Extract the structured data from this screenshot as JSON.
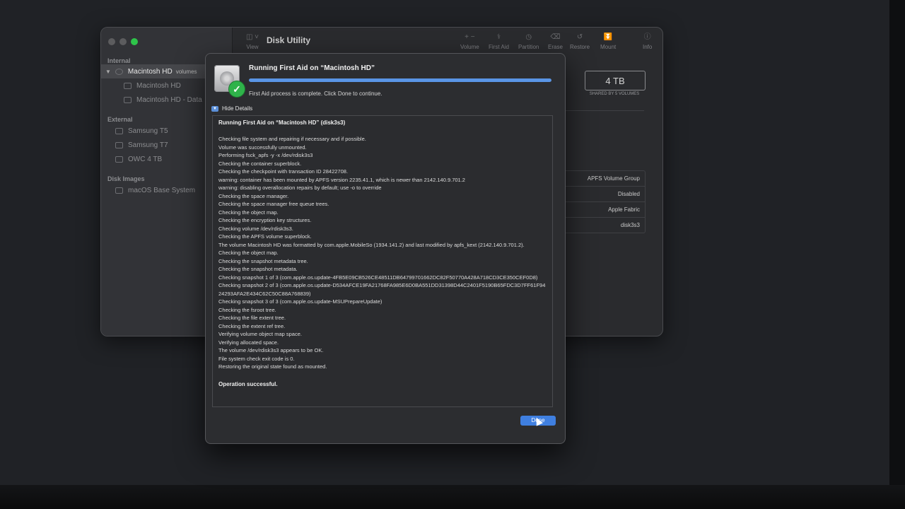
{
  "window": {
    "title": "Disk Utility",
    "traffic_colors": {
      "close": "#5c5c5e",
      "minimize": "#5c5c5e",
      "zoom": "#2ec44a"
    }
  },
  "toolbar": {
    "view_label": "View",
    "buttons": [
      {
        "label": "Volume",
        "icon": "plus-minus-icon"
      },
      {
        "label": "First Aid",
        "icon": "stethoscope-icon"
      },
      {
        "label": "Partition",
        "icon": "pie-clock-icon"
      },
      {
        "label": "Erase",
        "icon": "erase-icon"
      },
      {
        "label": "Restore",
        "icon": "restore-icon"
      },
      {
        "label": "Mount",
        "icon": "mount-icon"
      },
      {
        "label": "Info",
        "icon": "info-icon"
      }
    ]
  },
  "sidebar": {
    "sections": {
      "internal": "Internal",
      "external": "External",
      "disk_images": "Disk Images"
    },
    "internal_items": [
      {
        "label": "Macintosh HD",
        "badge": "volumes"
      },
      {
        "label": "Macintosh HD"
      },
      {
        "label": "Macintosh HD - Data"
      }
    ],
    "external_items": [
      {
        "label": "Samsung T5"
      },
      {
        "label": "Samsung T7"
      },
      {
        "label": "OWC 4 TB"
      }
    ],
    "disk_image_items": [
      {
        "label": "macOS Base System"
      }
    ]
  },
  "info_panel": {
    "capacity": "4 TB",
    "capacity_sub": "SHARED BY 5 VOLUMES",
    "rows": [
      "APFS Volume Group",
      "Disabled",
      "Apple Fabric",
      "disk3s3"
    ]
  },
  "sheet": {
    "title": "Running First Aid on “Macintosh HD”",
    "progress": 1.0,
    "status": "First Aid process is complete. Click Done to continue.",
    "details_toggle": "Hide Details",
    "log_heading": "Running First Aid on “Macintosh HD” (disk3s3)",
    "log_lines": [
      "Checking file system and repairing if necessary and if possible.",
      "Volume was successfully unmounted.",
      "Performing fsck_apfs -y -x /dev/rdisk3s3",
      "Checking the container superblock.",
      "Checking the checkpoint with transaction ID 28422708.",
      "warning: container has been mounted by APFS version 2235.41.1, which is newer than 2142.140.9.701.2",
      "warning: disabling overallocation repairs by default; use -o to override",
      "Checking the space manager.",
      "Checking the space manager free queue trees.",
      "Checking the object map.",
      "Checking the encryption key structures.",
      "Checking volume /dev/rdisk3s3.",
      "Checking the APFS volume superblock.",
      "The volume Macintosh HD was formatted by com.apple.MobileSo (1934.141.2) and last modified by apfs_kext (2142.140.9.701.2).",
      "Checking the object map.",
      "Checking the snapshot metadata tree.",
      "Checking the snapshot metadata.",
      "Checking snapshot 1 of 3 (com.apple.os.update-4FB5E09CB526CE48511DB64799701662DC82F50770A428A718CD3CE350CEF0D8)",
      "Checking snapshot 2 of 3 (com.apple.os.update-D534AFCE19FA21768FA985E6D0BA551DD31398D44C2401F5190B65FDC3D7FF61F9424293AFA2E434C62C50C88A768839)",
      "Checking snapshot 3 of 3 (com.apple.os.update-MSUPrepareUpdate)",
      "Checking the fsroot tree.",
      "Checking the file extent tree.",
      "Checking the extent ref tree.",
      "Verifying volume object map space.",
      "Verifying allocated space.",
      "The volume /dev/rdisk3s3 appears to be OK.",
      "File system check exit code is 0.",
      "Restoring the original state found as mounted."
    ],
    "log_footer": "Operation successful.",
    "done_label": "Done"
  }
}
